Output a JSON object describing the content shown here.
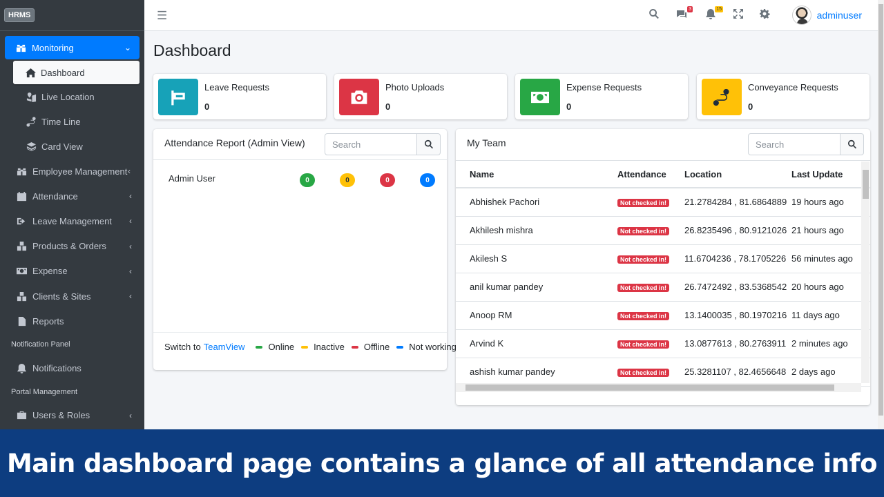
{
  "brand": "HRMS",
  "sidebar": {
    "monitoring": "Monitoring",
    "sub": [
      "Dashboard",
      "Live Location",
      "Time Line",
      "Card View"
    ],
    "items": [
      "Employee Management",
      "Attendance",
      "Leave Management",
      "Products & Orders",
      "Expense",
      "Clients & Sites",
      "Reports"
    ],
    "header_notifications": "Notification Panel",
    "notifications": "Notifications",
    "header_portal": "Portal Management",
    "users_roles": "Users & Roles"
  },
  "topbar": {
    "messages_count": "3",
    "notifications_count": "15",
    "username": "adminuser"
  },
  "page_title": "Dashboard",
  "info_boxes": [
    {
      "label": "Leave Requests",
      "value": "0",
      "color": "#17a2b8"
    },
    {
      "label": "Photo Uploads",
      "value": "0",
      "color": "#dc3545"
    },
    {
      "label": "Expense Requests",
      "value": "0",
      "color": "#28a745"
    },
    {
      "label": "Conveyance Requests",
      "value": "0",
      "color": "#ffc107"
    }
  ],
  "attendance_card": {
    "title": "Attendance Report (Admin View)",
    "search_placeholder": "Search",
    "user": "Admin User",
    "counts": [
      "0",
      "0",
      "0",
      "0"
    ],
    "switch_text": "Switch to",
    "switch_link": "TeamView",
    "legend": [
      "Online",
      "Inactive",
      "Offline",
      "Not working"
    ]
  },
  "team_card": {
    "title": "My Team",
    "search_placeholder": "Search",
    "columns": [
      "Name",
      "Attendance",
      "Location",
      "Last Update"
    ],
    "rows": [
      {
        "name": "Abhishek Pachori",
        "status": "Not checked in!",
        "location": "21.2784284 , 81.6864889",
        "update": "19 hours ago"
      },
      {
        "name": "Akhilesh mishra",
        "status": "Not checked in!",
        "location": "26.8235496 , 80.9121026",
        "update": "21 hours ago"
      },
      {
        "name": "Akilesh S",
        "status": "Not checked in!",
        "location": "11.6704236 , 78.1705226",
        "update": "56 minutes ago"
      },
      {
        "name": "anil kumar pandey",
        "status": "Not checked in!",
        "location": "26.7472492 , 83.5368542",
        "update": "20 hours ago"
      },
      {
        "name": "Anoop RM",
        "status": "Not checked in!",
        "location": "13.1400035 , 80.1970216",
        "update": "11 days ago"
      },
      {
        "name": "Arvind K",
        "status": "Not checked in!",
        "location": "13.0877613 , 80.2763911",
        "update": "2 minutes ago"
      },
      {
        "name": "ashish kumar pandey",
        "status": "Not checked in!",
        "location": "25.3281107 , 82.4656648",
        "update": "2 days ago"
      }
    ]
  },
  "banner": "Main dashboard page contains a glance of all attendance info"
}
